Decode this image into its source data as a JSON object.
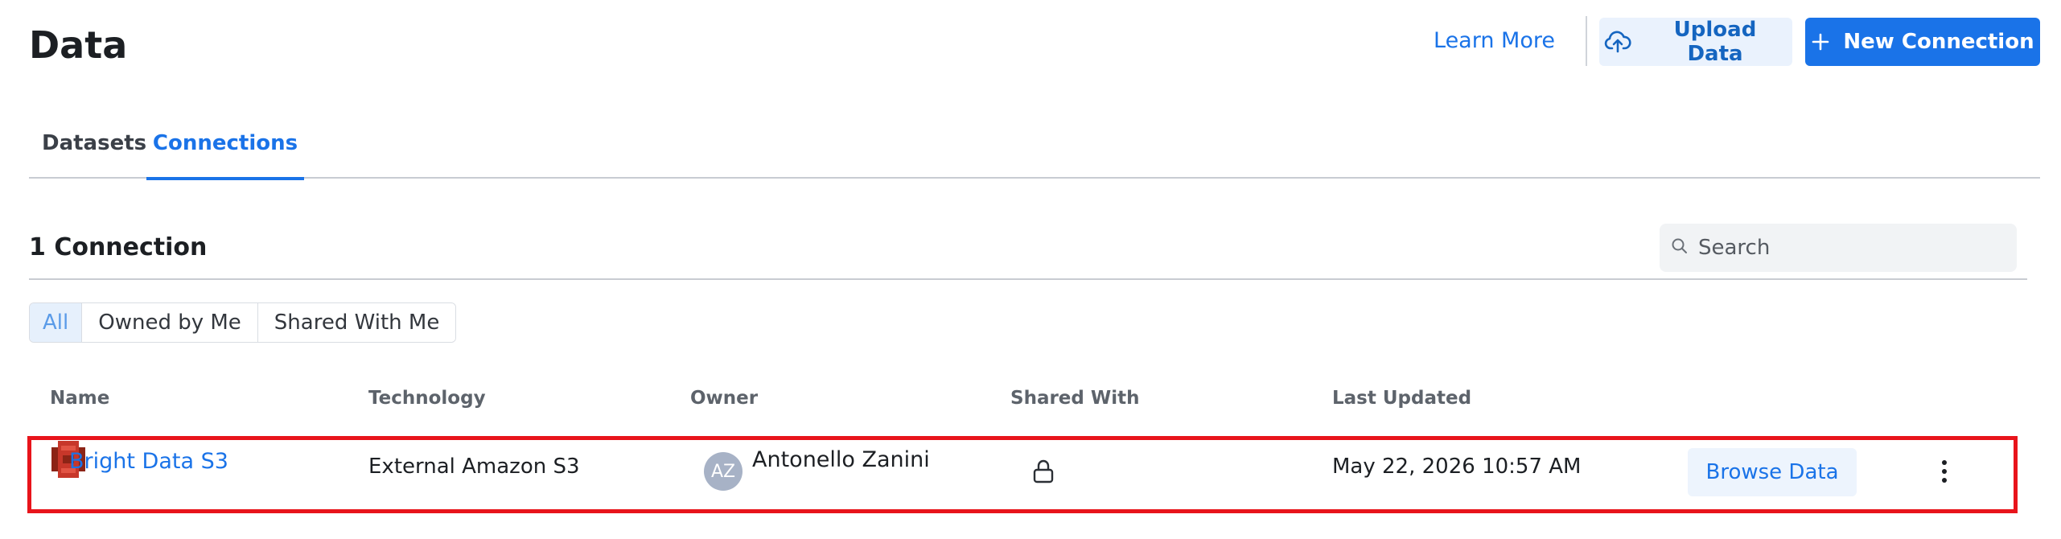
{
  "header": {
    "title": "Data",
    "learn_more": "Learn More",
    "upload_label": "Upload Data",
    "new_connection_label": "New Connection"
  },
  "tabs": [
    {
      "label": "Datasets",
      "active": false
    },
    {
      "label": "Connections",
      "active": true
    }
  ],
  "count_label": "1 Connection",
  "search": {
    "placeholder": "Search",
    "value": ""
  },
  "filters": [
    {
      "label": "All",
      "active": true
    },
    {
      "label": "Owned by Me",
      "active": false
    },
    {
      "label": "Shared With Me",
      "active": false
    }
  ],
  "table": {
    "columns": [
      "Name",
      "Technology",
      "Owner",
      "Shared With",
      "Last Updated"
    ],
    "rows": [
      {
        "name": "Bright Data S3",
        "icon": "amazon-s3-icon",
        "technology": "External Amazon S3",
        "owner_initials": "AZ",
        "owner": "Antonello Zanini",
        "shared_with_icon": "lock-icon",
        "last_updated": "May 22, 2026 10:57 AM",
        "action_label": "Browse Data"
      }
    ]
  },
  "colors": {
    "accent": "#1a73e8",
    "highlight_border": "#e8141b",
    "s3_red": "#c7372a"
  }
}
